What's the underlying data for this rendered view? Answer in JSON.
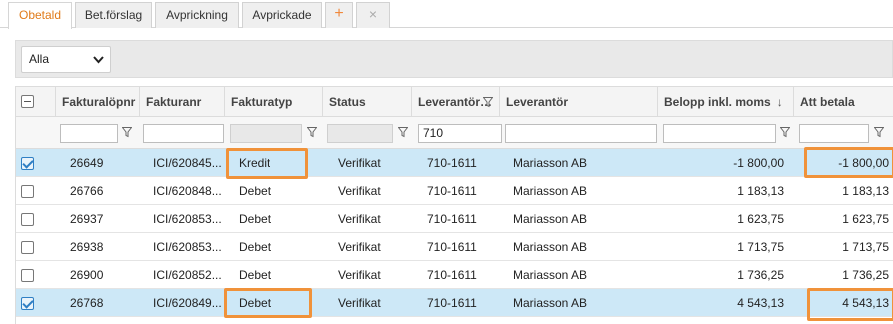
{
  "tabs": [
    {
      "label": "Obetald",
      "active": true
    },
    {
      "label": "Bet.förslag",
      "active": false
    },
    {
      "label": "Avprickning",
      "active": false
    },
    {
      "label": "Avprickade",
      "active": false
    }
  ],
  "tab_add_symbol": "+",
  "tab_close_symbol": "×",
  "filter_select": {
    "value": "Alla"
  },
  "columns": {
    "faktura_lopnr": "Fakturalöpnr",
    "fakturanr": "Fakturanr",
    "fakturatyp": "Fakturatyp",
    "status": "Status",
    "leverantor_nr": "Leverantör…",
    "leverantor": "Leverantör",
    "belopp": "Belopp inkl. moms",
    "att_betala": "Att betala"
  },
  "sort_symbol": "↓",
  "filters": {
    "leverantor_nr": "710"
  },
  "rows": [
    {
      "lopnr": "26649",
      "fakturanr": "ICI/620845...",
      "typ": "Kredit",
      "status": "Verifikat",
      "levnr": "710-1611",
      "leverantor": "Mariasson AB",
      "belopp": "-1 800,00",
      "att_betala": "-1 800,00",
      "selected": true
    },
    {
      "lopnr": "26766",
      "fakturanr": "ICI/620848...",
      "typ": "Debet",
      "status": "Verifikat",
      "levnr": "710-1611",
      "leverantor": "Mariasson AB",
      "belopp": "1 183,13",
      "att_betala": "1 183,13",
      "selected": false
    },
    {
      "lopnr": "26937",
      "fakturanr": "ICI/620853...",
      "typ": "Debet",
      "status": "Verifikat",
      "levnr": "710-1611",
      "leverantor": "Mariasson AB",
      "belopp": "1 623,75",
      "att_betala": "1 623,75",
      "selected": false
    },
    {
      "lopnr": "26938",
      "fakturanr": "ICI/620853...",
      "typ": "Debet",
      "status": "Verifikat",
      "levnr": "710-1611",
      "leverantor": "Mariasson AB",
      "belopp": "1 713,75",
      "att_betala": "1 713,75",
      "selected": false
    },
    {
      "lopnr": "26900",
      "fakturanr": "ICI/620852...",
      "typ": "Debet",
      "status": "Verifikat",
      "levnr": "710-1611",
      "leverantor": "Mariasson AB",
      "belopp": "1 736,25",
      "att_betala": "1 736,25",
      "selected": false
    },
    {
      "lopnr": "26768",
      "fakturanr": "ICI/620849...",
      "typ": "Debet",
      "status": "Verifikat",
      "levnr": "710-1611",
      "leverantor": "Mariasson AB",
      "belopp": "4 543,13",
      "att_betala": "4 543,13",
      "selected": true
    }
  ],
  "colors": {
    "accent": "#e07b1a",
    "highlight": "#f0923a",
    "selected_row": "#cde8f7"
  }
}
